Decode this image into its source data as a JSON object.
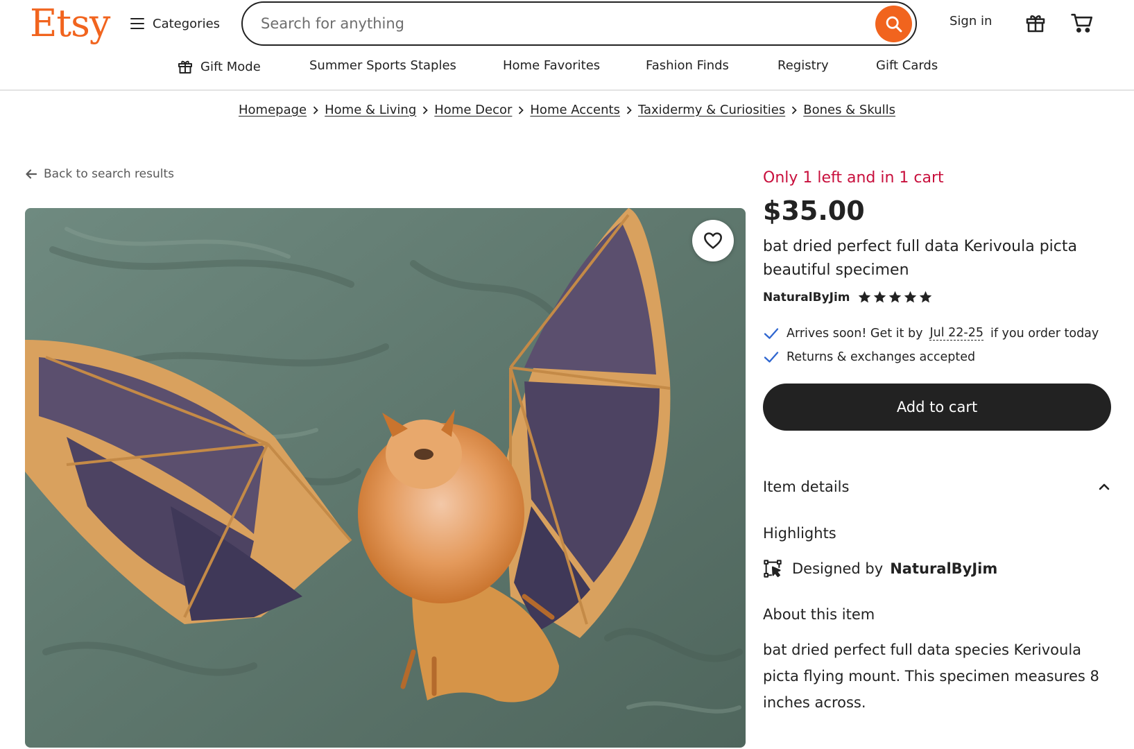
{
  "header": {
    "logo": "Etsy",
    "categories_label": "Categories",
    "search_placeholder": "Search for anything",
    "sign_in": "Sign in",
    "icons": [
      "menu-icon",
      "search-icon",
      "gift-icon",
      "cart-icon"
    ]
  },
  "nav": {
    "items": [
      "Gift Mode",
      "Summer Sports Staples",
      "Home Favorites",
      "Fashion Finds",
      "Registry",
      "Gift Cards"
    ]
  },
  "breadcrumb": [
    "Homepage",
    "Home & Living",
    "Home Decor",
    "Home Accents",
    "Taxidermy & Curiosities",
    "Bones & Skulls"
  ],
  "back_link": "Back to search results",
  "product": {
    "stock_notice": "Only 1 left and in 1 cart",
    "price": "$35.00",
    "title": "bat dried perfect full data Kerivoula picta beautiful specimen",
    "shop_name": "NaturalByJim",
    "rating": 5,
    "rating_max": 5,
    "delivery_prefix": "Arrives soon! Get it by",
    "delivery_dates": "Jul 22-25",
    "delivery_suffix": "if you order today",
    "returns": "Returns & exchanges accepted",
    "add_to_cart": "Add to cart"
  },
  "details": {
    "item_details_label": "Item details",
    "highlights_label": "Highlights",
    "designed_by_prefix": "Designed by",
    "designer": "NaturalByJim",
    "about_title": "About this item",
    "about_text": "bat dried perfect full data species Kerivoula picta flying mount. This specimen measures 8 inches across."
  },
  "colors": {
    "brand_orange": "#f1641e",
    "urgent_red": "#c80f3c",
    "check_blue": "#2f66d0",
    "button_dark": "#222222"
  }
}
